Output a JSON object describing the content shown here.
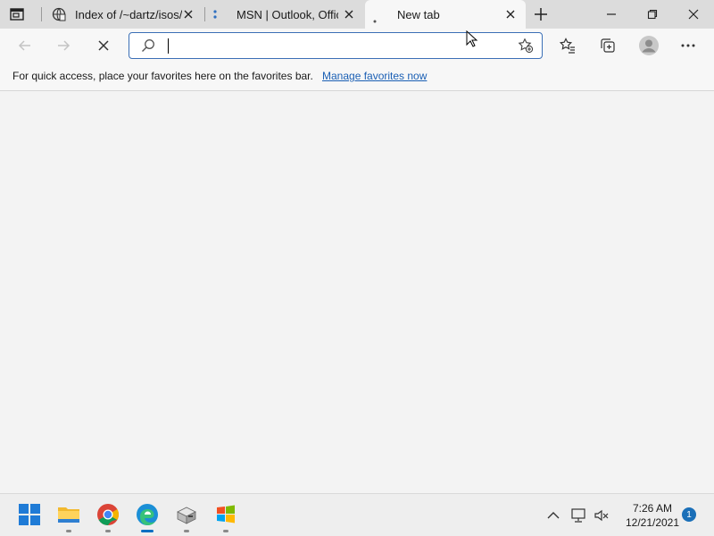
{
  "tabs": [
    {
      "title": "Index of /~dartz/isos/",
      "icon": "document-globe-icon",
      "active": false
    },
    {
      "title": "MSN | Outlook, Office",
      "icon": "msn-dots-icon",
      "active": false
    },
    {
      "title": "New tab",
      "icon": "loading-dot-icon",
      "active": true
    }
  ],
  "address_bar": {
    "value": "",
    "placeholder": ""
  },
  "favorites_bar": {
    "message": "For quick access, place your favorites here on the favorites bar.",
    "link": "Manage favorites now"
  },
  "taskbar": {
    "apps": [
      {
        "name": "start",
        "icon": "windows-start-icon"
      },
      {
        "name": "file-explorer",
        "icon": "folder-icon"
      },
      {
        "name": "chrome",
        "icon": "chrome-icon"
      },
      {
        "name": "edge",
        "icon": "edge-icon",
        "active": true
      },
      {
        "name": "network-app",
        "icon": "computer-box-icon"
      },
      {
        "name": "windows-app",
        "icon": "windows-flag-icon"
      }
    ],
    "time": "7:26 AM",
    "date": "12/21/2021",
    "notifications": "1"
  },
  "colors": {
    "accent": "#1a6fb8",
    "link": "#1a5fb4",
    "tabstrip": "#dcdcdc",
    "toolbar": "#f7f7f7"
  }
}
